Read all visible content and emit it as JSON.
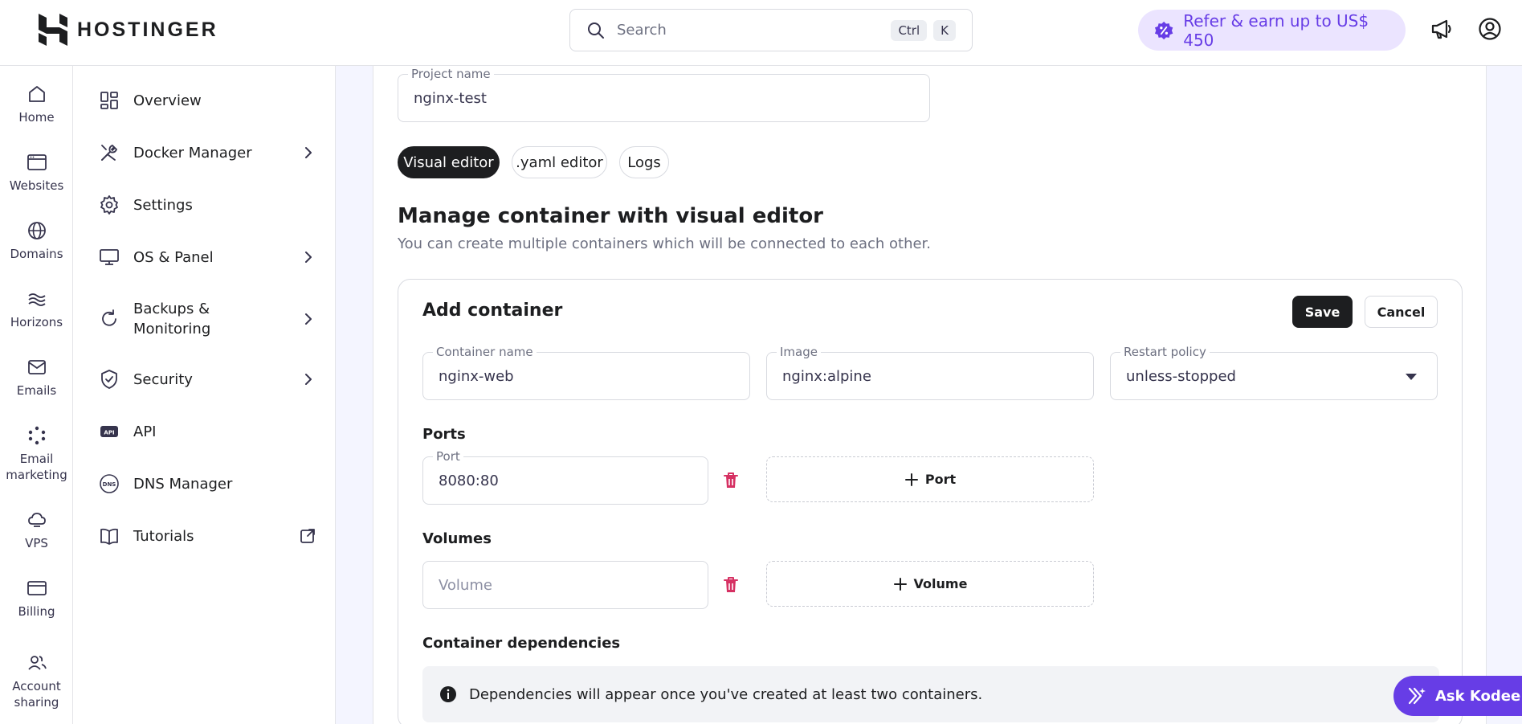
{
  "header": {
    "logo_text": "HOSTINGER",
    "search_placeholder": "Search",
    "search_shortcut": [
      "Ctrl",
      "K"
    ],
    "refer_label": "Refer & earn up to US$ 450",
    "icons": [
      "megaphone-icon",
      "user-account-icon"
    ]
  },
  "rail": {
    "items": [
      {
        "label": "Home",
        "icon": "home-icon"
      },
      {
        "label": "Websites",
        "icon": "website-icon"
      },
      {
        "label": "Domains",
        "icon": "globe-icon"
      },
      {
        "label": "Horizons",
        "icon": "horizons-icon"
      },
      {
        "label": "Emails",
        "icon": "mail-icon"
      },
      {
        "label": "Email\nmarketing",
        "icon": "email-marketing-icon"
      },
      {
        "label": "VPS",
        "icon": "vps-cloud-icon"
      },
      {
        "label": "Billing",
        "icon": "card-icon"
      },
      {
        "label": "Account\nsharing",
        "icon": "users-icon"
      }
    ]
  },
  "submenu": {
    "items": [
      {
        "label": "Overview",
        "icon": "grid-icon",
        "chevron": false
      },
      {
        "label": "Docker Manager",
        "icon": "tools-icon",
        "chevron": true
      },
      {
        "label": "Settings",
        "icon": "gear-icon",
        "chevron": false
      },
      {
        "label": "OS & Panel",
        "icon": "monitor-icon",
        "chevron": true
      },
      {
        "label": "Backups &\nMonitoring",
        "icon": "refresh-icon",
        "chevron": true
      },
      {
        "label": "Security",
        "icon": "shield-icon",
        "chevron": true
      },
      {
        "label": "API",
        "icon": "api-icon",
        "chevron": false
      },
      {
        "label": "DNS Manager",
        "icon": "dns-icon",
        "chevron": false
      },
      {
        "label": "Tutorials",
        "icon": "book-icon",
        "chevron": false,
        "external": true
      }
    ]
  },
  "project": {
    "label": "Project name",
    "value": "nginx-test"
  },
  "tabs": [
    {
      "label": "Visual editor",
      "active": true
    },
    {
      "label": ".yaml editor",
      "active": false
    },
    {
      "label": "Logs",
      "active": false
    }
  ],
  "editor": {
    "title": "Manage container with visual editor",
    "description": "You can create multiple containers which will be connected to each other."
  },
  "container_form": {
    "title": "Add container",
    "save_label": "Save",
    "cancel_label": "Cancel",
    "container_name_label": "Container name",
    "container_name_value": "nginx-web",
    "image_label": "Image",
    "image_value": "nginx:alpine",
    "restart_policy_label": "Restart policy",
    "restart_policy_value": "unless-stopped",
    "ports_title": "Ports",
    "port_label": "Port",
    "port_value": "8080:80",
    "add_port_label": "Port",
    "volumes_title": "Volumes",
    "volume_placeholder": "Volume",
    "add_volume_label": "Volume",
    "dependencies_title": "Container dependencies",
    "dependencies_info": "Dependencies will appear once you've created at least two containers."
  },
  "assistant": {
    "label": "Ask Kodee"
  },
  "colors": {
    "accent": "#673de6",
    "accent_soft": "#ebe4ff",
    "danger": "#d63163",
    "dark": "#1d1e20"
  }
}
